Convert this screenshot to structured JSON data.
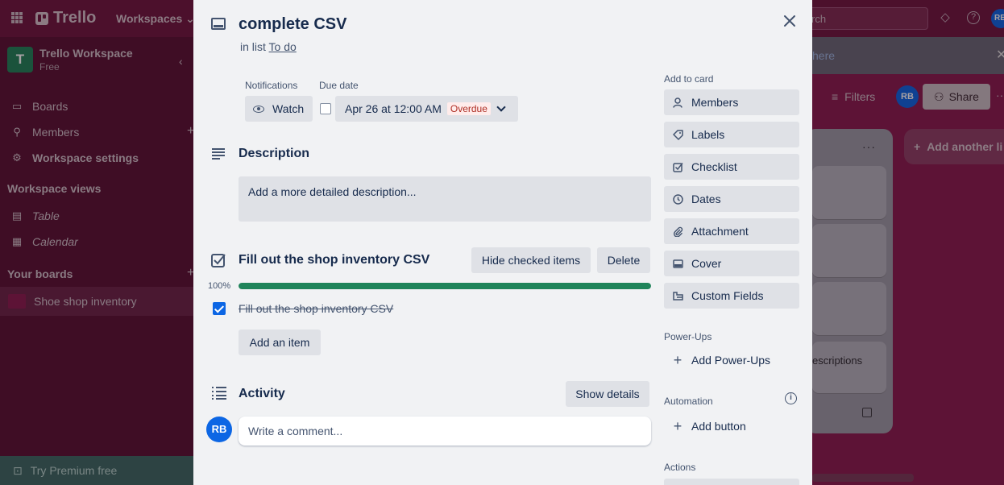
{
  "background": {
    "app_name": "Trello",
    "workspaces_menu": "Workspaces",
    "search_placeholder": "rch",
    "avatar_initials": "RB",
    "sidebar": {
      "workspace_name": "Trello Workspace",
      "workspace_tile": "T",
      "plan": "Free",
      "items": [
        {
          "label": "Boards"
        },
        {
          "label": "Members"
        },
        {
          "label": "Workspace settings"
        }
      ],
      "views_heading": "Workspace views",
      "views": [
        {
          "label": "Table"
        },
        {
          "label": "Calendar"
        }
      ],
      "your_boards_heading": "Your boards",
      "board_name": "Shoe shop inventory",
      "premium": "Try Premium free"
    },
    "board": {
      "banner_text": "here",
      "filters_label": "Filters",
      "share_label": "Share",
      "add_list_label": "Add another li",
      "card_snippet": "escriptions"
    }
  },
  "card": {
    "title": "complete CSV",
    "in_list_prefix": "in list",
    "list_name": "To do",
    "notifications_label": "Notifications",
    "watch_label": "Watch",
    "due_label": "Due date",
    "due_value": "Apr 26 at 12:00 AM",
    "due_status": "Overdue",
    "description": {
      "title": "Description",
      "placeholder": "Add a more detailed description..."
    },
    "checklist": {
      "title": "Fill out the shop inventory CSV",
      "hide_checked_label": "Hide checked items",
      "delete_label": "Delete",
      "progress_text": "100%",
      "progress_fraction": 1.0,
      "items": [
        {
          "text": "Fill out the shop inventory CSV",
          "checked": true
        }
      ],
      "add_item_label": "Add an item"
    },
    "activity": {
      "title": "Activity",
      "show_details_label": "Show details",
      "avatar_initials": "RB",
      "comment_placeholder": "Write a comment..."
    },
    "side": {
      "add_to_card_heading": "Add to card",
      "buttons": [
        {
          "label": "Members",
          "icon": "person-icon"
        },
        {
          "label": "Labels",
          "icon": "tag-icon"
        },
        {
          "label": "Checklist",
          "icon": "checkbox-icon"
        },
        {
          "label": "Dates",
          "icon": "clock-icon"
        },
        {
          "label": "Attachment",
          "icon": "paperclip-icon"
        },
        {
          "label": "Cover",
          "icon": "card-cover-icon"
        },
        {
          "label": "Custom Fields",
          "icon": "fields-icon"
        }
      ],
      "powerups_heading": "Power-Ups",
      "add_powerups_label": "Add Power-Ups",
      "automation_heading": "Automation",
      "add_button_label": "Add button",
      "actions_heading": "Actions"
    }
  },
  "colors": {
    "board_bg": "#8a1c4f",
    "progress_complete": "#1f845a",
    "overdue_text": "#ae2e24",
    "checkbox_checked": "#0c66e4"
  }
}
